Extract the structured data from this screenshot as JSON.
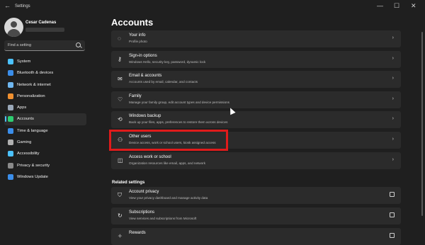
{
  "app_title": "Settings",
  "window_controls": {
    "minimize": "—",
    "maximize": "☐",
    "close": "✕"
  },
  "user": {
    "name": "Cesar Cadenas"
  },
  "search": {
    "placeholder": "Find a setting"
  },
  "sidebar": {
    "items": [
      {
        "label": "System",
        "icon": "system-icon",
        "color": "#4cc2ff"
      },
      {
        "label": "Bluetooth & devices",
        "icon": "bluetooth-icon",
        "color": "#3b8eea"
      },
      {
        "label": "Network & internet",
        "icon": "network-icon",
        "color": "#6fb7f0"
      },
      {
        "label": "Personalization",
        "icon": "brush-icon",
        "color": "#f09030"
      },
      {
        "label": "Apps",
        "icon": "apps-icon",
        "color": "#9aa8b8"
      },
      {
        "label": "Accounts",
        "icon": "accounts-icon",
        "color": "#2ecc71",
        "selected": true
      },
      {
        "label": "Time & language",
        "icon": "globe-icon",
        "color": "#3b8eea"
      },
      {
        "label": "Gaming",
        "icon": "gaming-icon",
        "color": "#b0b0b0"
      },
      {
        "label": "Accessibility",
        "icon": "accessibility-icon",
        "color": "#4cc2ff"
      },
      {
        "label": "Privacy & security",
        "icon": "shield-icon",
        "color": "#8a8a8a"
      },
      {
        "label": "Windows Update",
        "icon": "update-icon",
        "color": "#3b8eea"
      }
    ]
  },
  "page_title": "Accounts",
  "cards": [
    {
      "title": "Your info",
      "subtitle": "Profile photo",
      "icon": "person-icon",
      "glyph": "◌"
    },
    {
      "title": "Sign-in options",
      "subtitle": "Windows Hello, security key, password, dynamic lock",
      "icon": "key-icon",
      "glyph": "⚷"
    },
    {
      "title": "Email & accounts",
      "subtitle": "Accounts used by email, calendar, and contacts",
      "icon": "mail-icon",
      "glyph": "✉"
    },
    {
      "title": "Family",
      "subtitle": "Manage your family group, edit account types and device permissions",
      "icon": "heart-icon",
      "glyph": "♡"
    },
    {
      "title": "Windows backup",
      "subtitle": "Back up your files, apps, preferences to restore them across devices",
      "icon": "backup-icon",
      "glyph": "⟲"
    },
    {
      "title": "Other users",
      "subtitle": "Device access, work or school users, kiosk assigned access",
      "icon": "add-user-icon",
      "glyph": "⚇"
    },
    {
      "title": "Access work or school",
      "subtitle": "Organization resources like email, apps, and network",
      "icon": "briefcase-icon",
      "glyph": "◫"
    }
  ],
  "related_heading": "Related settings",
  "related_cards": [
    {
      "title": "Account privacy",
      "subtitle": "View your privacy dashboard and manage activity data",
      "icon": "shield-icon",
      "glyph": "⛉"
    },
    {
      "title": "Subscriptions",
      "subtitle": "View services and subscriptions from Microsoft",
      "icon": "refresh-icon",
      "glyph": "↻"
    },
    {
      "title": "Rewards",
      "subtitle": "",
      "icon": "gift-icon",
      "glyph": "✧"
    }
  ]
}
